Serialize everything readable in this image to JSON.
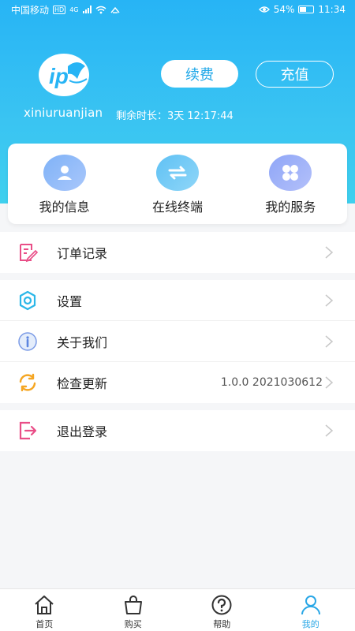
{
  "status_bar": {
    "carrier": "中国移动",
    "network_badge": "HD",
    "signal_label": "4G",
    "battery_percent": "54%",
    "battery_level": 0.54,
    "time": "11:34"
  },
  "profile": {
    "username": "xiniuruanjian",
    "remaining_label": "剩余时长：3天 12:17:44"
  },
  "actions": {
    "renew_label": "续费",
    "recharge_label": "充值"
  },
  "quick_menu": [
    {
      "label": "我的信息",
      "icon": "user-icon"
    },
    {
      "label": "在线终端",
      "icon": "swap-arrows-icon"
    },
    {
      "label": "我的服务",
      "icon": "clover-icon"
    }
  ],
  "menu_groups": [
    {
      "items": [
        {
          "label": "订单记录",
          "icon": "order-icon",
          "value": ""
        }
      ]
    },
    {
      "items": [
        {
          "label": "设置",
          "icon": "settings-icon",
          "value": ""
        },
        {
          "label": "关于我们",
          "icon": "info-icon",
          "value": ""
        },
        {
          "label": "检查更新",
          "icon": "refresh-icon",
          "value": "1.0.0 2021030612"
        }
      ]
    },
    {
      "items": [
        {
          "label": "退出登录",
          "icon": "logout-icon",
          "value": ""
        }
      ]
    }
  ],
  "tabs": [
    {
      "label": "首页",
      "icon": "home-icon",
      "active": false
    },
    {
      "label": "购买",
      "icon": "shopping-bag-icon",
      "active": false
    },
    {
      "label": "帮助",
      "icon": "help-icon",
      "active": false
    },
    {
      "label": "我的",
      "icon": "profile-icon",
      "active": true
    }
  ],
  "colors": {
    "header_gradient_top": "#27b4f5",
    "header_gradient_bottom": "#3fd0ee",
    "accent_blue": "#2aa7e6",
    "order_pink": "#e94e87",
    "settings_cyan": "#2bb7e8",
    "update_orange": "#f5a623"
  }
}
